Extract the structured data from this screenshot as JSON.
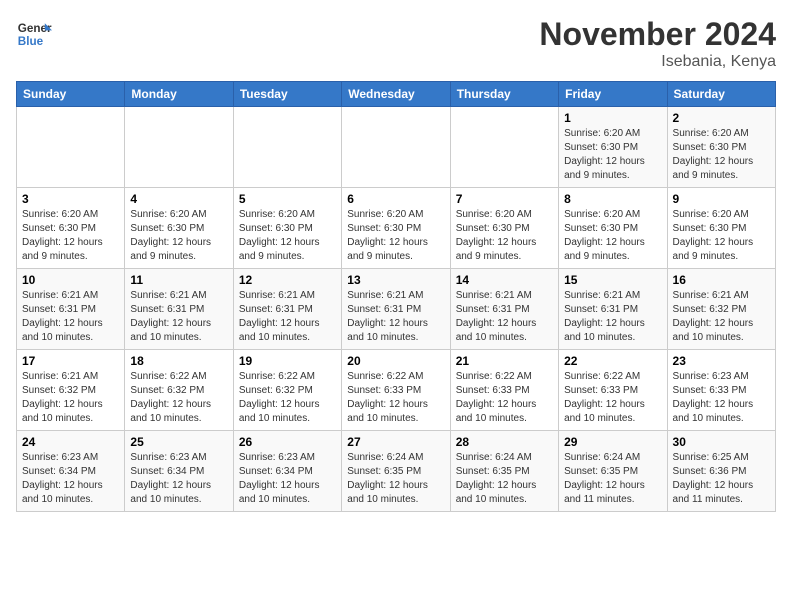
{
  "header": {
    "logo_line1": "General",
    "logo_line2": "Blue",
    "month_year": "November 2024",
    "location": "Isebania, Kenya"
  },
  "weekdays": [
    "Sunday",
    "Monday",
    "Tuesday",
    "Wednesday",
    "Thursday",
    "Friday",
    "Saturday"
  ],
  "weeks": [
    [
      {
        "day": "",
        "info": ""
      },
      {
        "day": "",
        "info": ""
      },
      {
        "day": "",
        "info": ""
      },
      {
        "day": "",
        "info": ""
      },
      {
        "day": "",
        "info": ""
      },
      {
        "day": "1",
        "info": "Sunrise: 6:20 AM\nSunset: 6:30 PM\nDaylight: 12 hours and 9 minutes."
      },
      {
        "day": "2",
        "info": "Sunrise: 6:20 AM\nSunset: 6:30 PM\nDaylight: 12 hours and 9 minutes."
      }
    ],
    [
      {
        "day": "3",
        "info": "Sunrise: 6:20 AM\nSunset: 6:30 PM\nDaylight: 12 hours and 9 minutes."
      },
      {
        "day": "4",
        "info": "Sunrise: 6:20 AM\nSunset: 6:30 PM\nDaylight: 12 hours and 9 minutes."
      },
      {
        "day": "5",
        "info": "Sunrise: 6:20 AM\nSunset: 6:30 PM\nDaylight: 12 hours and 9 minutes."
      },
      {
        "day": "6",
        "info": "Sunrise: 6:20 AM\nSunset: 6:30 PM\nDaylight: 12 hours and 9 minutes."
      },
      {
        "day": "7",
        "info": "Sunrise: 6:20 AM\nSunset: 6:30 PM\nDaylight: 12 hours and 9 minutes."
      },
      {
        "day": "8",
        "info": "Sunrise: 6:20 AM\nSunset: 6:30 PM\nDaylight: 12 hours and 9 minutes."
      },
      {
        "day": "9",
        "info": "Sunrise: 6:20 AM\nSunset: 6:30 PM\nDaylight: 12 hours and 9 minutes."
      }
    ],
    [
      {
        "day": "10",
        "info": "Sunrise: 6:21 AM\nSunset: 6:31 PM\nDaylight: 12 hours and 10 minutes."
      },
      {
        "day": "11",
        "info": "Sunrise: 6:21 AM\nSunset: 6:31 PM\nDaylight: 12 hours and 10 minutes."
      },
      {
        "day": "12",
        "info": "Sunrise: 6:21 AM\nSunset: 6:31 PM\nDaylight: 12 hours and 10 minutes."
      },
      {
        "day": "13",
        "info": "Sunrise: 6:21 AM\nSunset: 6:31 PM\nDaylight: 12 hours and 10 minutes."
      },
      {
        "day": "14",
        "info": "Sunrise: 6:21 AM\nSunset: 6:31 PM\nDaylight: 12 hours and 10 minutes."
      },
      {
        "day": "15",
        "info": "Sunrise: 6:21 AM\nSunset: 6:31 PM\nDaylight: 12 hours and 10 minutes."
      },
      {
        "day": "16",
        "info": "Sunrise: 6:21 AM\nSunset: 6:32 PM\nDaylight: 12 hours and 10 minutes."
      }
    ],
    [
      {
        "day": "17",
        "info": "Sunrise: 6:21 AM\nSunset: 6:32 PM\nDaylight: 12 hours and 10 minutes."
      },
      {
        "day": "18",
        "info": "Sunrise: 6:22 AM\nSunset: 6:32 PM\nDaylight: 12 hours and 10 minutes."
      },
      {
        "day": "19",
        "info": "Sunrise: 6:22 AM\nSunset: 6:32 PM\nDaylight: 12 hours and 10 minutes."
      },
      {
        "day": "20",
        "info": "Sunrise: 6:22 AM\nSunset: 6:33 PM\nDaylight: 12 hours and 10 minutes."
      },
      {
        "day": "21",
        "info": "Sunrise: 6:22 AM\nSunset: 6:33 PM\nDaylight: 12 hours and 10 minutes."
      },
      {
        "day": "22",
        "info": "Sunrise: 6:22 AM\nSunset: 6:33 PM\nDaylight: 12 hours and 10 minutes."
      },
      {
        "day": "23",
        "info": "Sunrise: 6:23 AM\nSunset: 6:33 PM\nDaylight: 12 hours and 10 minutes."
      }
    ],
    [
      {
        "day": "24",
        "info": "Sunrise: 6:23 AM\nSunset: 6:34 PM\nDaylight: 12 hours and 10 minutes."
      },
      {
        "day": "25",
        "info": "Sunrise: 6:23 AM\nSunset: 6:34 PM\nDaylight: 12 hours and 10 minutes."
      },
      {
        "day": "26",
        "info": "Sunrise: 6:23 AM\nSunset: 6:34 PM\nDaylight: 12 hours and 10 minutes."
      },
      {
        "day": "27",
        "info": "Sunrise: 6:24 AM\nSunset: 6:35 PM\nDaylight: 12 hours and 10 minutes."
      },
      {
        "day": "28",
        "info": "Sunrise: 6:24 AM\nSunset: 6:35 PM\nDaylight: 12 hours and 10 minutes."
      },
      {
        "day": "29",
        "info": "Sunrise: 6:24 AM\nSunset: 6:35 PM\nDaylight: 12 hours and 11 minutes."
      },
      {
        "day": "30",
        "info": "Sunrise: 6:25 AM\nSunset: 6:36 PM\nDaylight: 12 hours and 11 minutes."
      }
    ]
  ]
}
